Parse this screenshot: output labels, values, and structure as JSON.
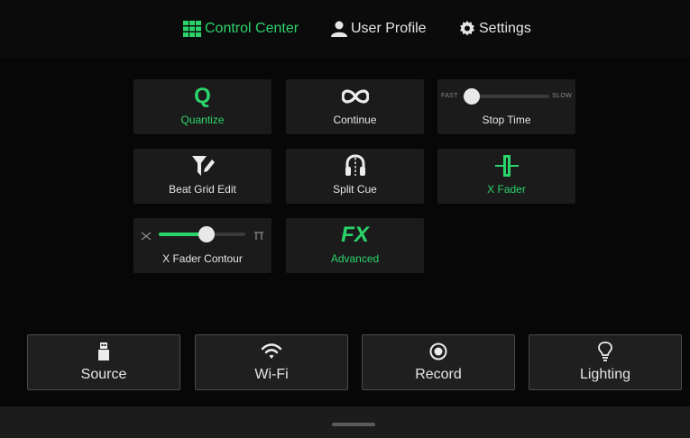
{
  "tabs": [
    {
      "label": "Control Center",
      "icon": "grid-icon",
      "active": true
    },
    {
      "label": "User Profile",
      "icon": "user-icon",
      "active": false
    },
    {
      "label": "Settings",
      "icon": "gear-icon",
      "active": false
    }
  ],
  "tiles": {
    "quantize": {
      "icon_text": "Q",
      "label": "Quantize",
      "active": true
    },
    "continue": {
      "icon": "infinity-icon",
      "label": "Continue"
    },
    "stop_time": {
      "label": "Stop Time",
      "min_label": "FAST",
      "max_label": "SLOW",
      "level": 0.1
    },
    "beat_grid_edit": {
      "icon": "grid-edit-icon",
      "label": "Beat Grid Edit"
    },
    "split_cue": {
      "icon": "headphones-icon",
      "label": "Split Cue"
    },
    "x_fader": {
      "icon": "crossfader-icon",
      "label": "X Fader",
      "active": true
    },
    "x_fader_contour": {
      "label": "X Fader Contour",
      "level": 0.55,
      "left_icon": "curve-x-icon",
      "right_icon": "curve-cut-icon"
    },
    "fx": {
      "icon_text": "FX",
      "label": "Advanced",
      "active": true
    }
  },
  "buttons": [
    {
      "label": "Source",
      "icon": "usb-icon"
    },
    {
      "label": "Wi-Fi",
      "icon": "wifi-icon"
    },
    {
      "label": "Record",
      "icon": "record-icon"
    },
    {
      "label": "Lighting",
      "icon": "bulb-icon"
    }
  ],
  "colors": {
    "accent": "#2bd46b",
    "tile_bg": "#1b1b1b",
    "background": "#070707"
  }
}
